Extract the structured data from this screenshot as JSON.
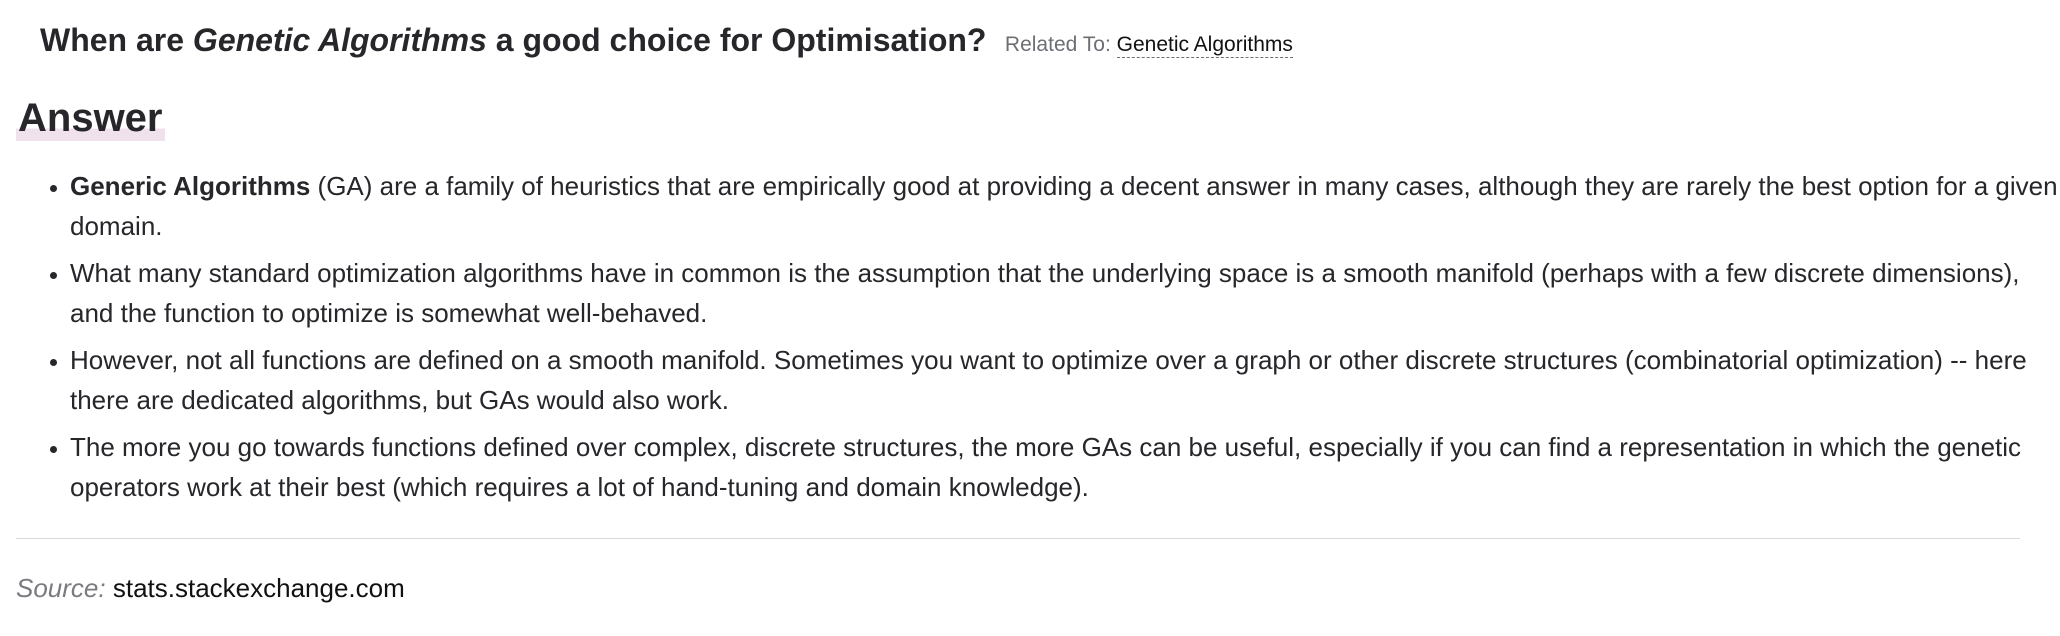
{
  "question": {
    "title_prefix": "When are ",
    "title_emphasis": "Genetic Algorithms",
    "title_suffix": " a good choice for Optimisation?",
    "related_label": "Related To:",
    "related_link": "Genetic Algorithms"
  },
  "answer": {
    "heading": "Answer",
    "bullets": [
      {
        "bold": "Generic Algorithms",
        "text": " (GA) are a family of heuristics that are empirically good at providing a decent answer in many cases, although they are rarely the best option for a given domain."
      },
      {
        "text": "What many standard optimization algorithms have in common is the assumption that the underlying space is a smooth manifold (perhaps with a few discrete dimensions), and the function to optimize is somewhat well-behaved."
      },
      {
        "text": "However, not all functions are defined on a smooth manifold. Sometimes you want to optimize over a graph or other discrete structures (combinatorial optimization) -- here there are dedicated algorithms, but GAs would also work."
      },
      {
        "text": "The more you go towards functions defined over complex, discrete structures, the more GAs can be useful, especially if you can find a representation in which the genetic operators work at their best (which requires a lot of hand-tuning and domain knowledge)."
      }
    ]
  },
  "source": {
    "label": "Source:",
    "value": "stats.stackexchange.com"
  }
}
